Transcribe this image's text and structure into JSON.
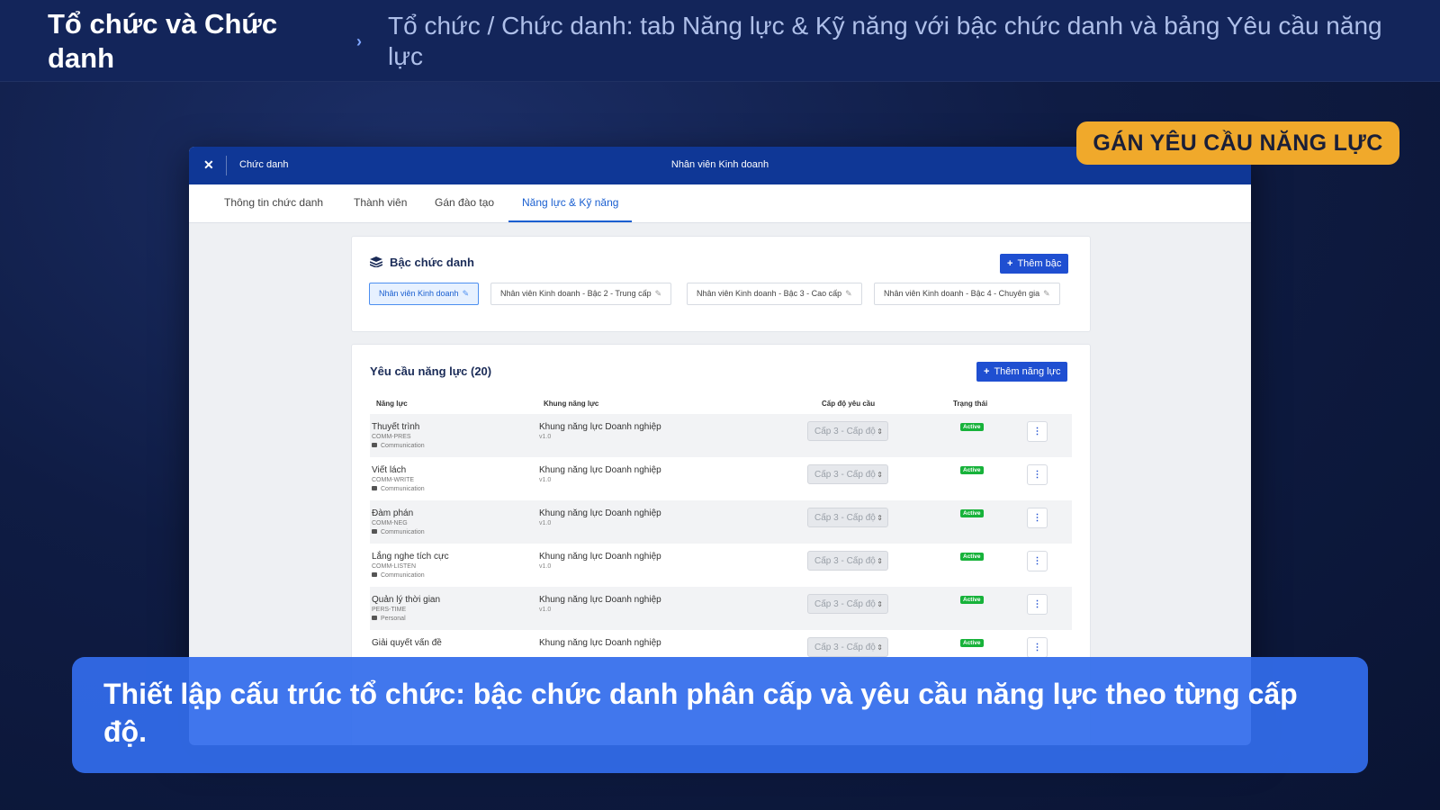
{
  "header": {
    "section": "Tổ chức và Chức danh",
    "description": "Tổ chức / Chức danh: tab Năng lực & Kỹ năng với bậc chức danh và bảng Yêu cầu năng lực"
  },
  "badge": "GÁN YÊU CẦU NĂNG LỰC",
  "window": {
    "breadcrumb": "Chức danh",
    "title": "Nhân viên Kinh doanh",
    "tabs": [
      "Thông tin chức danh",
      "Thành viên",
      "Gán đào tạo",
      "Năng lực & Kỹ năng"
    ],
    "active_tab": "Năng lực & Kỹ năng"
  },
  "levels_card": {
    "title": "Bậc chức danh",
    "add_button": "Thêm bậc",
    "levels": [
      "Nhân viên Kinh doanh",
      "Nhân viên Kinh doanh - Bậc 2 - Trung cấp",
      "Nhân viên Kinh doanh - Bậc 3 - Cao cấp",
      "Nhân viên Kinh doanh - Bậc 4 - Chuyên gia"
    ]
  },
  "requirements_card": {
    "title": "Yêu cầu năng lực (20)",
    "add_button": "Thêm năng lực",
    "columns": [
      "Năng lực",
      "Khung năng lực",
      "Cấp độ yêu cầu",
      "Trạng thái"
    ],
    "rows": [
      {
        "name": "Thuyết trình",
        "code": "COMM-PRES",
        "category": "Communication",
        "framework": "Khung năng lực Doanh nghiệp",
        "version": "v1.0",
        "level": "Cấp 3 - Cấp độ",
        "status": "Active"
      },
      {
        "name": "Viết lách",
        "code": "COMM-WRITE",
        "category": "Communication",
        "framework": "Khung năng lực Doanh nghiệp",
        "version": "v1.0",
        "level": "Cấp 3 - Cấp độ",
        "status": "Active"
      },
      {
        "name": "Đàm phán",
        "code": "COMM-NEG",
        "category": "Communication",
        "framework": "Khung năng lực Doanh nghiệp",
        "version": "v1.0",
        "level": "Cấp 3 - Cấp độ",
        "status": "Active"
      },
      {
        "name": "Lắng nghe tích cực",
        "code": "COMM-LISTEN",
        "category": "Communication",
        "framework": "Khung năng lực Doanh nghiệp",
        "version": "v1.0",
        "level": "Cấp 3 - Cấp độ",
        "status": "Active"
      },
      {
        "name": "Quản lý thời gian",
        "code": "PERS-TIME",
        "category": "Personal",
        "framework": "Khung năng lực Doanh nghiệp",
        "version": "v1.0",
        "level": "Cấp 3 - Cấp độ",
        "status": "Active"
      },
      {
        "name": "Giải quyết vấn đề",
        "code": "",
        "category": "",
        "framework": "Khung năng lực Doanh nghiệp",
        "version": "",
        "level": "Cấp 3 - Cấp độ",
        "status": "Active"
      }
    ]
  },
  "caption": "Thiết lập cấu trúc tổ chức: bậc chức danh phân cấp và yêu cầu năng lực theo từng cấp độ."
}
